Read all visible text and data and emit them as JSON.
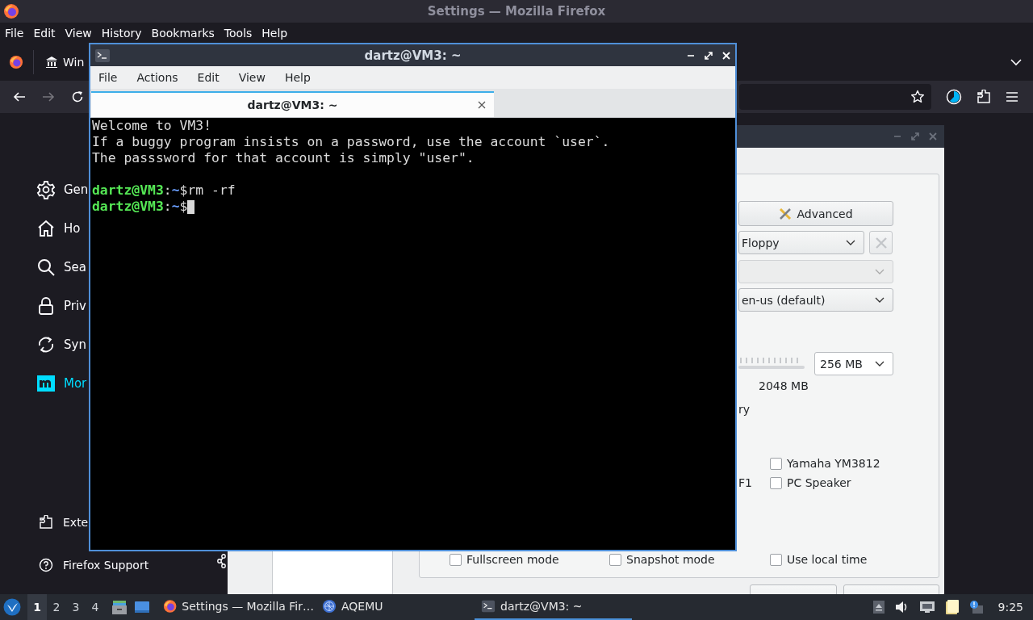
{
  "firefox": {
    "title": "Settings — Mozilla Firefox",
    "menu": [
      "File",
      "Edit",
      "View",
      "History",
      "Bookmarks",
      "Tools",
      "Help"
    ],
    "tabs": [
      {
        "label": "Win"
      }
    ],
    "sidebar": {
      "items": [
        {
          "label": "Gen",
          "kind": "gear",
          "selected": false
        },
        {
          "label": "Ho",
          "kind": "home",
          "selected": false
        },
        {
          "label": "Sea",
          "kind": "search",
          "selected": false
        },
        {
          "label": "Priv",
          "kind": "lock",
          "selected": false
        },
        {
          "label": "Syn",
          "kind": "sync",
          "selected": false
        },
        {
          "label": "Mor",
          "kind": "m",
          "selected": true
        }
      ],
      "footer": [
        {
          "label": "Exte",
          "kind": "puzzle"
        },
        {
          "label": "Firefox Support",
          "kind": "help"
        }
      ]
    }
  },
  "dialog": {
    "advanced_button": "Advanced",
    "floppy_select": "Floppy",
    "language_select": "en-us (default)",
    "memory_select": "256 MB",
    "memory_max": "2048 MB",
    "fragment_1": "ry",
    "check_rows": [
      {
        "prefix": null,
        "label": "Yamaha YM3812",
        "checked": false
      },
      {
        "prefix": "F1",
        "label": "PC Speaker",
        "checked": false
      }
    ],
    "bottom_checks": [
      {
        "label": "Fullscreen mode",
        "checked": false
      },
      {
        "label": "Snapshot mode",
        "checked": false
      },
      {
        "label": "Use local time",
        "checked": false
      }
    ]
  },
  "terminal": {
    "title": "dartz@VM3: ~",
    "menu": [
      "File",
      "Actions",
      "Edit",
      "View",
      "Help"
    ],
    "tab": "dartz@VM3: ~",
    "lines": [
      {
        "kind": "text",
        "text": "Welcome to VM3!"
      },
      {
        "kind": "text",
        "text": "If a buggy program insists on a password, use the account `user`."
      },
      {
        "kind": "text",
        "text": "The passsword for that account is simply \"user\"."
      },
      {
        "kind": "blank"
      },
      {
        "kind": "prompt",
        "user": "dartz@VM3",
        "sep": ":",
        "path": "~",
        "symbol": "$",
        "command": "rm -rf",
        "cursor": false
      },
      {
        "kind": "prompt",
        "user": "dartz@VM3",
        "sep": ":",
        "path": "~",
        "symbol": "$",
        "cursor": true
      }
    ]
  },
  "taskbar": {
    "workspaces": [
      {
        "label": "1",
        "selected": true
      },
      {
        "label": "2",
        "selected": false
      },
      {
        "label": "3",
        "selected": false
      },
      {
        "label": "4",
        "selected": false
      }
    ],
    "tasks": [
      {
        "label": "Settings — Mozilla Fir…",
        "kind": "browser",
        "selected": false
      },
      {
        "label": "AQEMU",
        "kind": "globe",
        "selected": false
      },
      {
        "label": "dartz@VM3: ~",
        "kind": "terminal",
        "selected": true
      }
    ],
    "clock": "9:25"
  }
}
